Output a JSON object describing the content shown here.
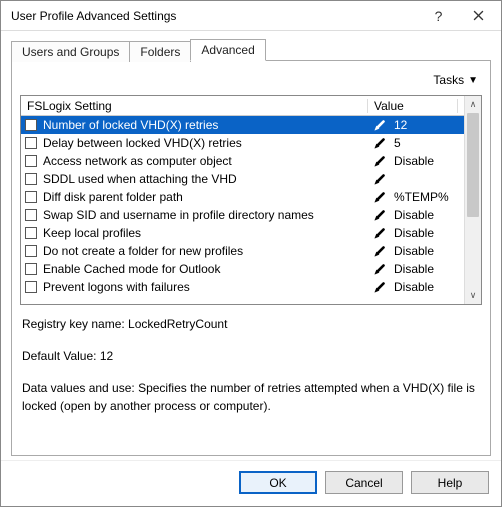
{
  "window": {
    "title": "User Profile Advanced Settings"
  },
  "tabs": {
    "t0": "Users and Groups",
    "t1": "Folders",
    "t2": "Advanced"
  },
  "tasks": {
    "label": "Tasks"
  },
  "header": {
    "setting": "FSLogix Setting",
    "value": "Value"
  },
  "rows": [
    {
      "label": "Number of locked VHD(X) retries",
      "value": "12",
      "selected": true
    },
    {
      "label": "Delay between locked VHD(X) retries",
      "value": "5"
    },
    {
      "label": "Access network as computer object",
      "value": "Disable"
    },
    {
      "label": "SDDL used when attaching the VHD",
      "value": ""
    },
    {
      "label": "Diff disk parent folder path",
      "value": "%TEMP%"
    },
    {
      "label": "Swap SID and username in profile directory names",
      "value": "Disable"
    },
    {
      "label": "Keep local profiles",
      "value": "Disable"
    },
    {
      "label": "Do not create a folder for new profiles",
      "value": "Disable"
    },
    {
      "label": "Enable Cached mode for Outlook",
      "value": "Disable"
    },
    {
      "label": "Prevent logons with failures",
      "value": "Disable"
    }
  ],
  "details": {
    "regkey_label": "Registry key name: ",
    "regkey": "LockedRetryCount",
    "default_label": "Default Value: ",
    "default": "12",
    "desc_label": "Data values and use: ",
    "desc": "Specifies the number of retries attempted when a VHD(X) file is locked (open by another process or computer)."
  },
  "buttons": {
    "ok": "OK",
    "cancel": "Cancel",
    "help": "Help"
  }
}
